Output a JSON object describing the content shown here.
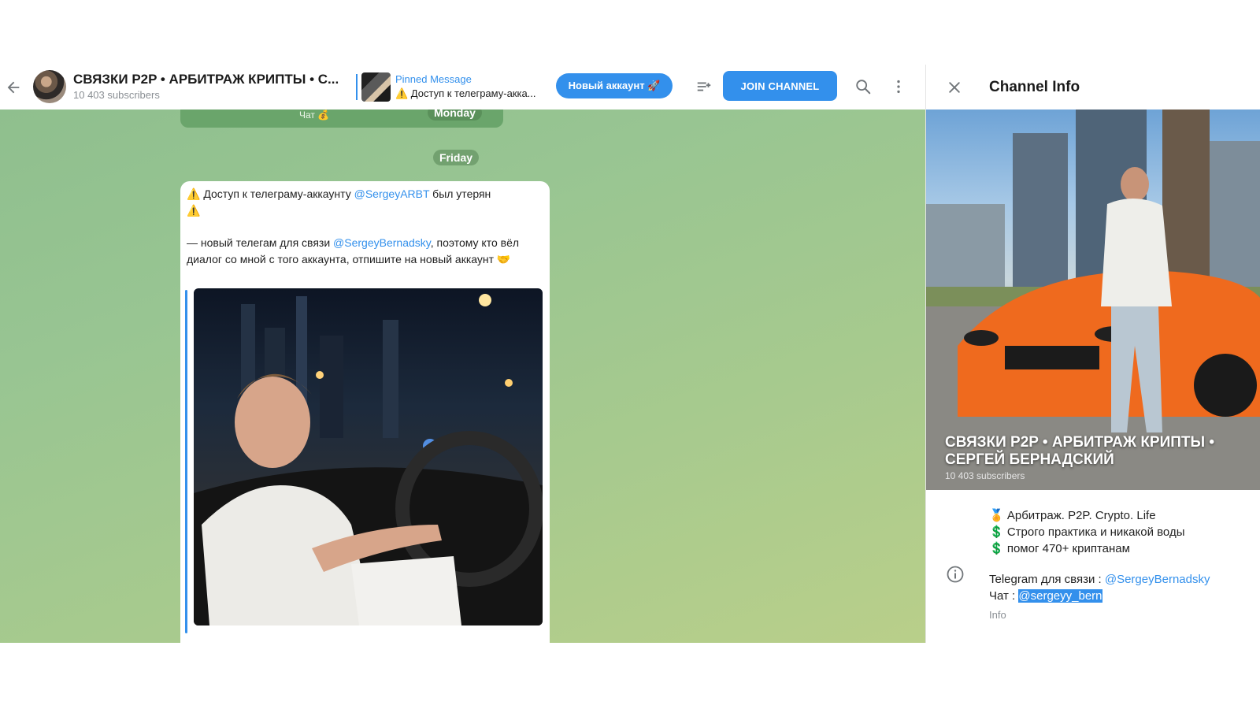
{
  "header": {
    "title": "СВЯЗКИ P2P • АРБИТРАЖ КРИПТЫ • С...",
    "subscribers": "10 403 subscribers",
    "pinned_title": "Pinned Message",
    "pinned_text": "⚠️ Доступ к телеграму-акка...",
    "new_account_label": "Новый аккаунт 🚀",
    "join_label": "JOIN CHANNEL"
  },
  "chat": {
    "prev_chat_label": "Чат 💰",
    "day_monday": "Monday",
    "day_friday": "Friday",
    "message": {
      "line1_prefix": "⚠️ Доступ к телеграму-аккаунту ",
      "line1_link": "@SergeyARBT",
      "line1_suffix": " был утерян",
      "line2": "⚠️",
      "para2_prefix": "— новый телегам для связи ",
      "para2_link": "@SergeyBernadsky",
      "para2_suffix": ", поэтому кто вёл диалог со мной с того аккаунта, отпишите на новый аккаунт 🤝"
    }
  },
  "info_panel": {
    "title": "Channel Info",
    "cover_title": "СВЯЗКИ P2P • АРБИТРАЖ КРИПТЫ • СЕРГЕЙ БЕРНАДСКИЙ",
    "cover_subscribers": "10 403 subscribers",
    "bio": [
      "🏅 Арбитраж. P2P. Crypto. Life",
      "💲 Строго практика и никакой воды",
      "💲 помог 470+ криптанам"
    ],
    "contact_prefix": "Telegram для связи : ",
    "contact_link": "@SergeyBernadsky",
    "chat_prefix": "Чат : ",
    "chat_link": "@sergeyy_bern",
    "info_label": "Info"
  },
  "colors": {
    "accent": "#3390ec",
    "chat_bg": "#98c592",
    "header_bg": "#ffffff"
  }
}
